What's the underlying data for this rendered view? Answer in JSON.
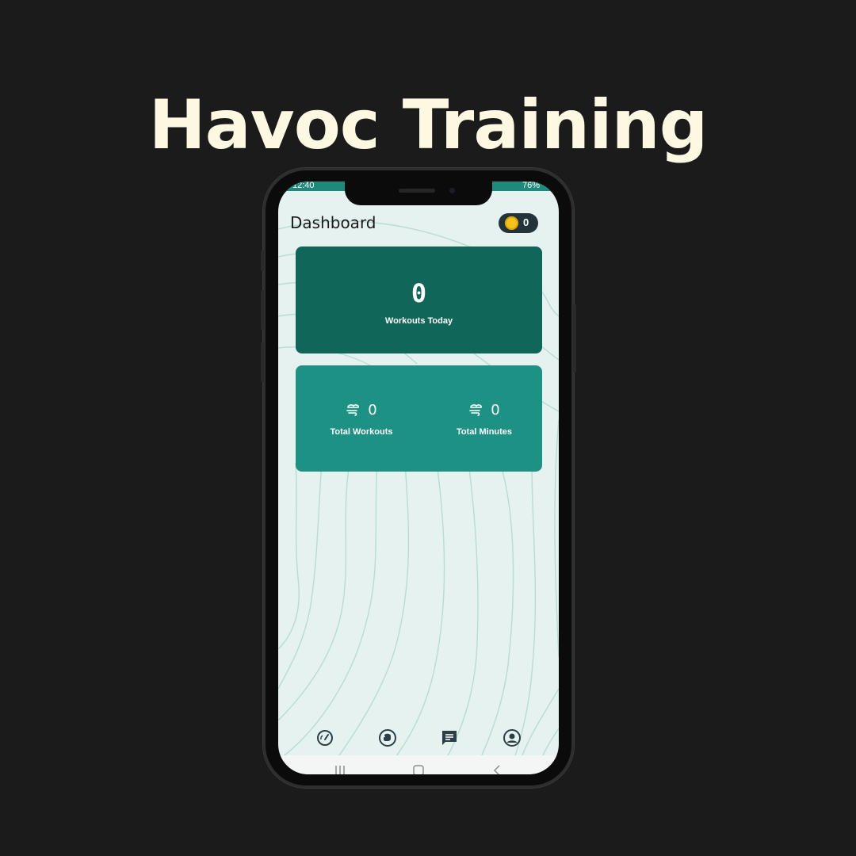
{
  "promo": {
    "title": "Havoc Training"
  },
  "status_bar": {
    "time": "12:40",
    "battery": "76%"
  },
  "header": {
    "title": "Dashboard",
    "coins": "0"
  },
  "today_card": {
    "value": "0",
    "label": "Workouts Today"
  },
  "totals_card": {
    "total_workouts": {
      "value": "0",
      "label": "Total Workouts",
      "icon": "wind-icon"
    },
    "total_minutes": {
      "value": "0",
      "label": "Total Minutes",
      "icon": "wind-icon"
    }
  },
  "bottom_nav": {
    "items": [
      {
        "icon": "speedometer-icon",
        "name": "dashboard"
      },
      {
        "icon": "boxing-glove-icon",
        "name": "training"
      },
      {
        "icon": "chat-icon",
        "name": "messages"
      },
      {
        "icon": "profile-icon",
        "name": "profile"
      }
    ]
  },
  "colors": {
    "background": "#1b1b1b",
    "title_color": "#fdf8e2",
    "card_dark": "#0f6659",
    "card_light": "#1d9184",
    "screen_bg": "#e6f2ef",
    "coin": "#f4c21b"
  }
}
